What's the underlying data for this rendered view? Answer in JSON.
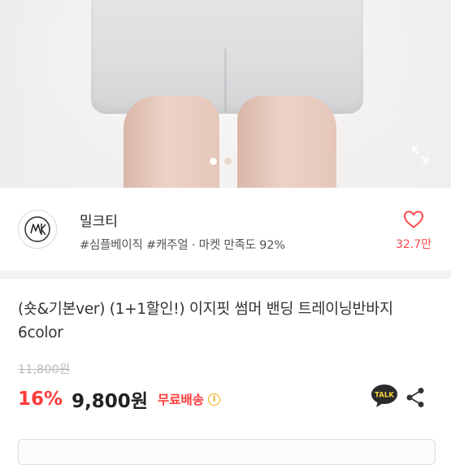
{
  "gallery": {
    "image_count": 2,
    "active_index": 0
  },
  "seller": {
    "name": "밀크티",
    "tags": "#심플베이직 #캐주얼 · 마켓 만족도 92%",
    "like_count": "32.7만"
  },
  "product": {
    "title": "(숏&기본ver) (1+1할인!) 이지핏 썸머 밴딩 트레이닝반바지 6color",
    "original_price": "11,800원",
    "discount": "16%",
    "price": "9,800원",
    "shipping": "무료배송",
    "info_glyph": "i"
  },
  "icons": {
    "talk_label": "TALK"
  },
  "colors": {
    "accent": "#ff3b3b",
    "like": "#ff4a4a",
    "info": "#f0a800",
    "talk_bg": "#2b2b2b",
    "talk_text": "#f6d43a"
  }
}
